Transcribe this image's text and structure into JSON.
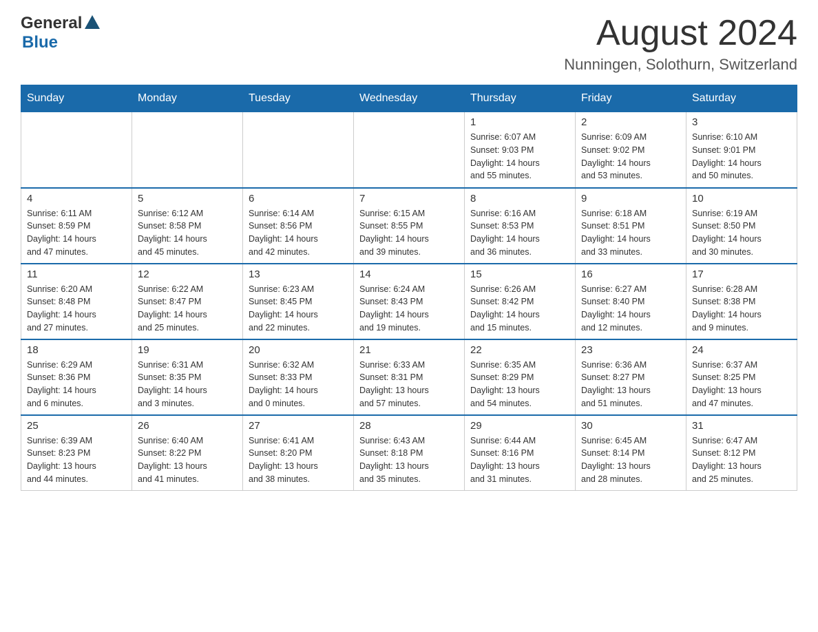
{
  "header": {
    "logo_general": "General",
    "logo_blue": "Blue",
    "month_title": "August 2024",
    "location": "Nunningen, Solothurn, Switzerland"
  },
  "days_of_week": [
    "Sunday",
    "Monday",
    "Tuesday",
    "Wednesday",
    "Thursday",
    "Friday",
    "Saturday"
  ],
  "weeks": [
    {
      "days": [
        {
          "number": "",
          "info": ""
        },
        {
          "number": "",
          "info": ""
        },
        {
          "number": "",
          "info": ""
        },
        {
          "number": "",
          "info": ""
        },
        {
          "number": "1",
          "info": "Sunrise: 6:07 AM\nSunset: 9:03 PM\nDaylight: 14 hours\nand 55 minutes."
        },
        {
          "number": "2",
          "info": "Sunrise: 6:09 AM\nSunset: 9:02 PM\nDaylight: 14 hours\nand 53 minutes."
        },
        {
          "number": "3",
          "info": "Sunrise: 6:10 AM\nSunset: 9:01 PM\nDaylight: 14 hours\nand 50 minutes."
        }
      ]
    },
    {
      "days": [
        {
          "number": "4",
          "info": "Sunrise: 6:11 AM\nSunset: 8:59 PM\nDaylight: 14 hours\nand 47 minutes."
        },
        {
          "number": "5",
          "info": "Sunrise: 6:12 AM\nSunset: 8:58 PM\nDaylight: 14 hours\nand 45 minutes."
        },
        {
          "number": "6",
          "info": "Sunrise: 6:14 AM\nSunset: 8:56 PM\nDaylight: 14 hours\nand 42 minutes."
        },
        {
          "number": "7",
          "info": "Sunrise: 6:15 AM\nSunset: 8:55 PM\nDaylight: 14 hours\nand 39 minutes."
        },
        {
          "number": "8",
          "info": "Sunrise: 6:16 AM\nSunset: 8:53 PM\nDaylight: 14 hours\nand 36 minutes."
        },
        {
          "number": "9",
          "info": "Sunrise: 6:18 AM\nSunset: 8:51 PM\nDaylight: 14 hours\nand 33 minutes."
        },
        {
          "number": "10",
          "info": "Sunrise: 6:19 AM\nSunset: 8:50 PM\nDaylight: 14 hours\nand 30 minutes."
        }
      ]
    },
    {
      "days": [
        {
          "number": "11",
          "info": "Sunrise: 6:20 AM\nSunset: 8:48 PM\nDaylight: 14 hours\nand 27 minutes."
        },
        {
          "number": "12",
          "info": "Sunrise: 6:22 AM\nSunset: 8:47 PM\nDaylight: 14 hours\nand 25 minutes."
        },
        {
          "number": "13",
          "info": "Sunrise: 6:23 AM\nSunset: 8:45 PM\nDaylight: 14 hours\nand 22 minutes."
        },
        {
          "number": "14",
          "info": "Sunrise: 6:24 AM\nSunset: 8:43 PM\nDaylight: 14 hours\nand 19 minutes."
        },
        {
          "number": "15",
          "info": "Sunrise: 6:26 AM\nSunset: 8:42 PM\nDaylight: 14 hours\nand 15 minutes."
        },
        {
          "number": "16",
          "info": "Sunrise: 6:27 AM\nSunset: 8:40 PM\nDaylight: 14 hours\nand 12 minutes."
        },
        {
          "number": "17",
          "info": "Sunrise: 6:28 AM\nSunset: 8:38 PM\nDaylight: 14 hours\nand 9 minutes."
        }
      ]
    },
    {
      "days": [
        {
          "number": "18",
          "info": "Sunrise: 6:29 AM\nSunset: 8:36 PM\nDaylight: 14 hours\nand 6 minutes."
        },
        {
          "number": "19",
          "info": "Sunrise: 6:31 AM\nSunset: 8:35 PM\nDaylight: 14 hours\nand 3 minutes."
        },
        {
          "number": "20",
          "info": "Sunrise: 6:32 AM\nSunset: 8:33 PM\nDaylight: 14 hours\nand 0 minutes."
        },
        {
          "number": "21",
          "info": "Sunrise: 6:33 AM\nSunset: 8:31 PM\nDaylight: 13 hours\nand 57 minutes."
        },
        {
          "number": "22",
          "info": "Sunrise: 6:35 AM\nSunset: 8:29 PM\nDaylight: 13 hours\nand 54 minutes."
        },
        {
          "number": "23",
          "info": "Sunrise: 6:36 AM\nSunset: 8:27 PM\nDaylight: 13 hours\nand 51 minutes."
        },
        {
          "number": "24",
          "info": "Sunrise: 6:37 AM\nSunset: 8:25 PM\nDaylight: 13 hours\nand 47 minutes."
        }
      ]
    },
    {
      "days": [
        {
          "number": "25",
          "info": "Sunrise: 6:39 AM\nSunset: 8:23 PM\nDaylight: 13 hours\nand 44 minutes."
        },
        {
          "number": "26",
          "info": "Sunrise: 6:40 AM\nSunset: 8:22 PM\nDaylight: 13 hours\nand 41 minutes."
        },
        {
          "number": "27",
          "info": "Sunrise: 6:41 AM\nSunset: 8:20 PM\nDaylight: 13 hours\nand 38 minutes."
        },
        {
          "number": "28",
          "info": "Sunrise: 6:43 AM\nSunset: 8:18 PM\nDaylight: 13 hours\nand 35 minutes."
        },
        {
          "number": "29",
          "info": "Sunrise: 6:44 AM\nSunset: 8:16 PM\nDaylight: 13 hours\nand 31 minutes."
        },
        {
          "number": "30",
          "info": "Sunrise: 6:45 AM\nSunset: 8:14 PM\nDaylight: 13 hours\nand 28 minutes."
        },
        {
          "number": "31",
          "info": "Sunrise: 6:47 AM\nSunset: 8:12 PM\nDaylight: 13 hours\nand 25 minutes."
        }
      ]
    }
  ]
}
